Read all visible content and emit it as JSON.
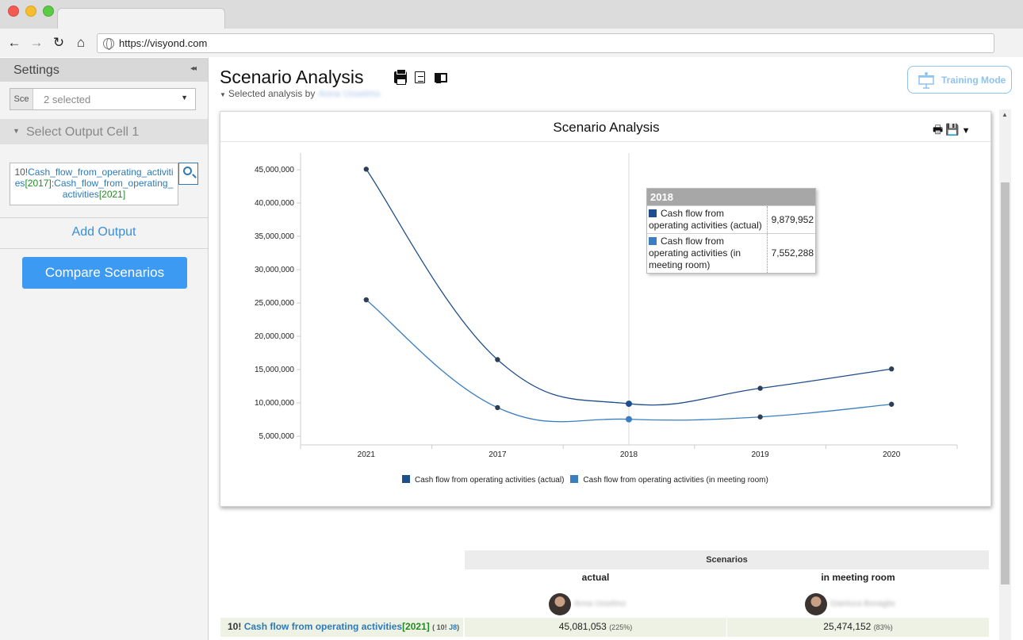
{
  "browser": {
    "url": "https://visyond.com"
  },
  "sidebar": {
    "title": "Settings",
    "collapse_glyph": "◂◂",
    "scenario_prefix": "Sce",
    "scenario_value": "2 selected",
    "output_section_label": "Select Output Cell 1",
    "cell_ref": {
      "prefix": "10!",
      "name1": "Cash_flow_from_operating_activities",
      "year1": "[2017]",
      "sep": ":",
      "name2": "Cash_flow_from_operating_activities",
      "year2": "[2021]"
    },
    "add_output_label": "Add Output",
    "compare_label": "Compare Scenarios"
  },
  "header": {
    "title": "Scenario Analysis",
    "subtitle_prefix": "Selected analysis by",
    "subtitle_name": "Anna Usselmo",
    "training_label": "Training Mode"
  },
  "chart": {
    "title": "Scenario Analysis",
    "tooltip": {
      "header": "2018",
      "rows": [
        {
          "name": "Cash flow from operating activities (actual)",
          "value": "9,879,952",
          "color": "#1f4e8c"
        },
        {
          "name": "Cash flow from operating activities (in meeting room)",
          "value": "7,552,288",
          "color": "#3a7ebf"
        }
      ]
    }
  },
  "chart_data": {
    "type": "line",
    "title": "Scenario Analysis",
    "categories": [
      "2021",
      "2017",
      "2018",
      "2019",
      "2020"
    ],
    "y_ticks": [
      5000000,
      10000000,
      15000000,
      20000000,
      25000000,
      30000000,
      35000000,
      40000000,
      45000000
    ],
    "y_tick_labels": [
      "5,000,000",
      "10,000,000",
      "15,000,000",
      "20,000,000",
      "25,000,000",
      "30,000,000",
      "35,000,000",
      "40,000,000",
      "45,000,000"
    ],
    "ylim": [
      3700000,
      47500000
    ],
    "series": [
      {
        "name": "Cash flow from operating activities (actual)",
        "color": "#1f4e8c",
        "values": [
          45081053,
          16500000,
          9879952,
          12200000,
          15100000
        ]
      },
      {
        "name": "Cash flow from operating activities (in meeting room)",
        "color": "#3a7ebf",
        "values": [
          25474152,
          9300000,
          7552288,
          7900000,
          9800000
        ]
      }
    ],
    "highlight_category": "2018",
    "legend_position": "bottom"
  },
  "table": {
    "group_header": "Scenarios",
    "columns": [
      {
        "name": "actual",
        "user": "Anna Usselmo"
      },
      {
        "name": "in meeting room",
        "user": "Gianluca Bonaglia"
      }
    ],
    "row": {
      "prefix": "10!",
      "label": "Cash flow from operating activities",
      "year": "[2021]",
      "ref_prefix": "( 10!",
      "ref_cell": "J8",
      "ref_suffix": ")",
      "values": [
        {
          "value": "45,081,053",
          "pct": "(225%)"
        },
        {
          "value": "25,474,152",
          "pct": "(83%)"
        }
      ]
    }
  }
}
